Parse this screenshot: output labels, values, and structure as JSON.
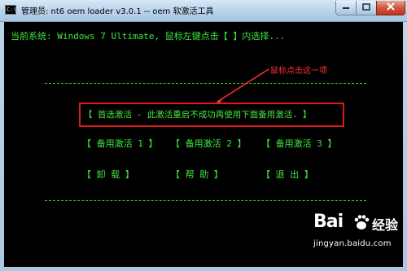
{
  "window": {
    "title": "管理员: nt6 oem loader v3.0.1  -- oem 软激活工具",
    "icon_text": "C:\\",
    "controls": {
      "minimize": "▭",
      "maximize": "□",
      "close": "✕"
    }
  },
  "console": {
    "status_line": "当前系统: Windows 7 Ultimate, 鼠标左键点击【 】内选择...",
    "main_option": "【 首选激活 - 此激活重启不成功再使用下面备用激活. 】",
    "row1": [
      "【 备用激活 1 】",
      "【 备用激活 2 】",
      "【 备用激活 3 】"
    ],
    "row2": [
      "【   卸  载   】",
      "【   帮  助   】",
      "【   退  出   】"
    ]
  },
  "annotation": {
    "label": "鼠标点击这一项",
    "color": "#ff3030"
  },
  "watermark": {
    "logo": "Bai",
    "brand": "经验",
    "url": "jingyan.baidu.com"
  },
  "colors": {
    "console_text": "#3ee53e",
    "highlight_box": "#e01818"
  }
}
